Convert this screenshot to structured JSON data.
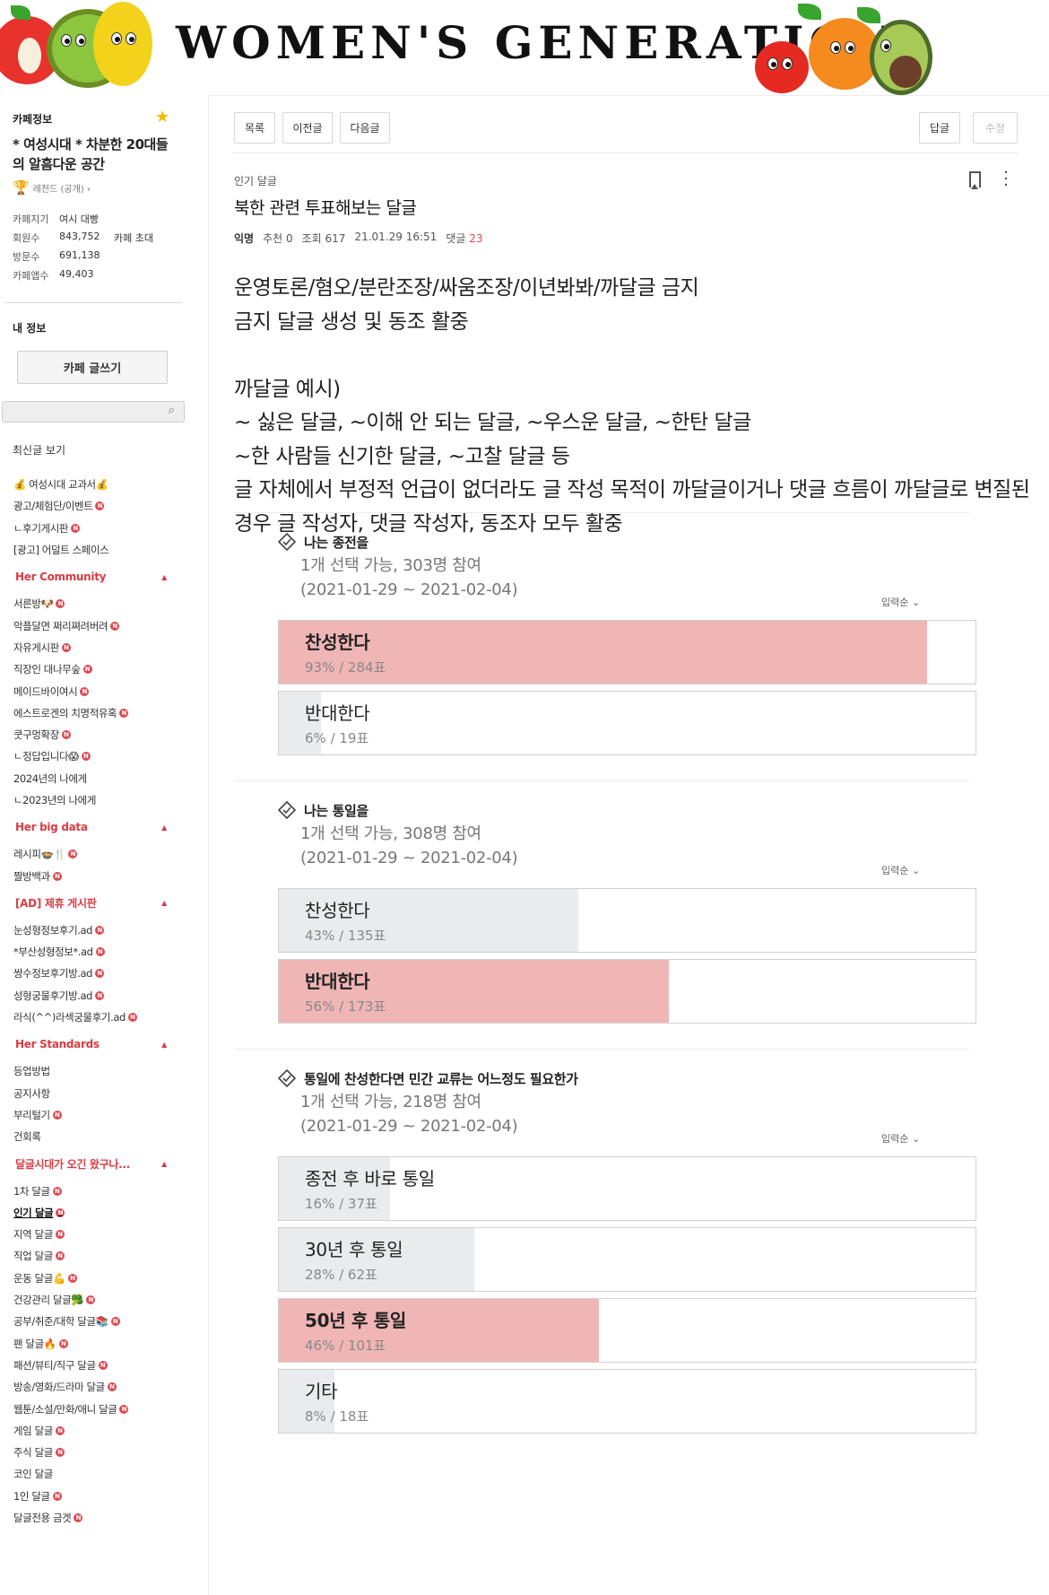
{
  "banner": {
    "title": "WOMEN'S GENERATION"
  },
  "sidebar": {
    "cafe_info_label": "카페정보",
    "cafe_name": "* 여성시대 * 차분한 20대들의 알흠다운 공간",
    "level": "레전드 (공개) ›",
    "stats": {
      "manager_label": "카페지기",
      "manager_value": "여시 대빵",
      "members_label": "회원수",
      "members_value": "843,752",
      "invite_label": "카페 초대",
      "visits_label": "방문수",
      "visits_value": "691,138",
      "app_label": "카페앱수",
      "app_value": "49,403"
    },
    "my_info": "내 정보",
    "write_button": "카페 글쓰기",
    "search_placeholder": "",
    "recent": "최신글 보기",
    "menu_top": [
      {
        "label": "💰 여성시대 교과서💰",
        "new": false
      },
      {
        "label": "광고/체험단/이벤트",
        "new": true
      },
      {
        "label": "ㄴ후기게시판",
        "new": true
      },
      {
        "label": "[광고] 어덜트 스페이스",
        "new": false
      }
    ],
    "groups": [
      {
        "title": "Her Community",
        "items": [
          {
            "label": "서른방🐶",
            "new": true
          },
          {
            "label": "악플달면 쩌리쪄려버려",
            "new": true
          },
          {
            "label": "자유게시판",
            "new": true
          },
          {
            "label": "직장인 대나무숲",
            "new": true
          },
          {
            "label": "메이드바이여시",
            "new": true
          },
          {
            "label": "에스트로겐의 치명적유혹",
            "new": true
          },
          {
            "label": "쿳구멍확장",
            "new": true
          },
          {
            "label": "ㄴ정답입니다😱",
            "new": true
          },
          {
            "label": "2024년의 나에게",
            "new": false
          },
          {
            "label": "ㄴ2023년의 나에게",
            "new": false
          }
        ]
      },
      {
        "title": "Her big data",
        "items": [
          {
            "label": "레시피🍲🍴",
            "new": true
          },
          {
            "label": "짤방백과",
            "new": true
          }
        ]
      },
      {
        "title": "[AD] 제휴 게시판",
        "items": [
          {
            "label": "눈성형정보후기.ad",
            "new": true
          },
          {
            "label": "*부산성형정보*.ad",
            "new": true
          },
          {
            "label": "쌍수정보후기방.ad",
            "new": true
          },
          {
            "label": "성형궁물후기방.ad",
            "new": true
          },
          {
            "label": "라식(^^)라섹궁물후기.ad",
            "new": true
          }
        ]
      },
      {
        "title": "Her Standards",
        "items": [
          {
            "label": "등업방법",
            "new": false
          },
          {
            "label": "공지사항",
            "new": false
          },
          {
            "label": "부리털기",
            "new": true
          },
          {
            "label": "건회록",
            "new": false
          }
        ]
      },
      {
        "title": "달글시대가 오긴 왔구나...",
        "items": [
          {
            "label": "1차 달글",
            "new": true
          },
          {
            "label": "인기 달글",
            "new": true,
            "active": true
          },
          {
            "label": "지역 달글",
            "new": true
          },
          {
            "label": "직업 달글",
            "new": true
          },
          {
            "label": "운동 달글💪",
            "new": true
          },
          {
            "label": "건강관리 달글🥦",
            "new": true
          },
          {
            "label": "공부/취준/대학 달글📚",
            "new": true
          },
          {
            "label": "팬 달글🔥",
            "new": true
          },
          {
            "label": "패션/뷰티/직구 달글",
            "new": true
          },
          {
            "label": "방송/영화/드라마 달글",
            "new": true
          },
          {
            "label": "웹툰/소설/만화/애니 달글",
            "new": true
          },
          {
            "label": "게임 달글",
            "new": true
          },
          {
            "label": "주식 달글",
            "new": true
          },
          {
            "label": "코인 달글",
            "new": false
          },
          {
            "label": "1인 달글",
            "new": true
          },
          {
            "label": "달글전용 금겟",
            "new": true
          }
        ]
      }
    ]
  },
  "toolbar": {
    "list": "목록",
    "prev": "이전글",
    "next": "다음글",
    "reply": "답글",
    "edit": "수정"
  },
  "post": {
    "board": "인기 달글",
    "title": "북한 관련 투표해보는 달글",
    "author": "익명",
    "likes": "추천 0",
    "views": "조회 617",
    "date": "21.01.29 16:51",
    "comments_label": "댓글",
    "comments_count": "23",
    "body": "운영토론/혐오/분란조장/싸움조장/이년봐봐/까달글 금지\n금지 달글 생성 및 동조 활중\n\n까달글 예시)\n~ 싫은 달글, ~이해 안 되는 달글, ~우스운 달글, ~한탄 달글\n~한 사람들 신기한 달글, ~고찰 달글 등\n글 자체에서 부정적 언급이 없더라도 글 작성 목적이 까달글이거나 댓글 흐름이 까달글로 변질된 경우 글 작성자, 댓글 작성자, 동조자 모두 활중"
  },
  "polls": [
    {
      "question": "나는 종전을",
      "info": "1개 선택 가능, 303명 참여",
      "period": "(2021-01-29 ~ 2021-02-04)",
      "sort": "입력순 ⌄",
      "options": [
        {
          "label": "찬성한다",
          "result": "93% / 284표",
          "ratio": 0.93,
          "winner": true
        },
        {
          "label": "반대한다",
          "result": "6% / 19표",
          "ratio": 0.06,
          "winner": false
        }
      ]
    },
    {
      "question": "나는 통일을",
      "info": "1개 선택 가능, 308명 참여",
      "period": "(2021-01-29 ~ 2021-02-04)",
      "sort": "입력순 ⌄",
      "options": [
        {
          "label": "찬성한다",
          "result": "43% / 135표",
          "ratio": 0.43,
          "winner": false
        },
        {
          "label": "반대한다",
          "result": "56% / 173표",
          "ratio": 0.56,
          "winner": true
        }
      ]
    },
    {
      "question": "통일에 찬성한다면 민간 교류는 어느정도 필요한가",
      "info": "1개 선택 가능, 218명 참여",
      "period": "(2021-01-29 ~ 2021-02-04)",
      "sort": "입력순 ⌄",
      "options": [
        {
          "label": "종전 후 바로 통일",
          "result": "16% / 37표",
          "ratio": 0.16,
          "winner": false
        },
        {
          "label": "30년 후 통일",
          "result": "28% / 62표",
          "ratio": 0.28,
          "winner": false
        },
        {
          "label": "50년 후 통일",
          "result": "46% / 101표",
          "ratio": 0.46,
          "winner": true
        },
        {
          "label": "기타",
          "result": "8% / 18표",
          "ratio": 0.08,
          "winner": false
        }
      ]
    }
  ]
}
